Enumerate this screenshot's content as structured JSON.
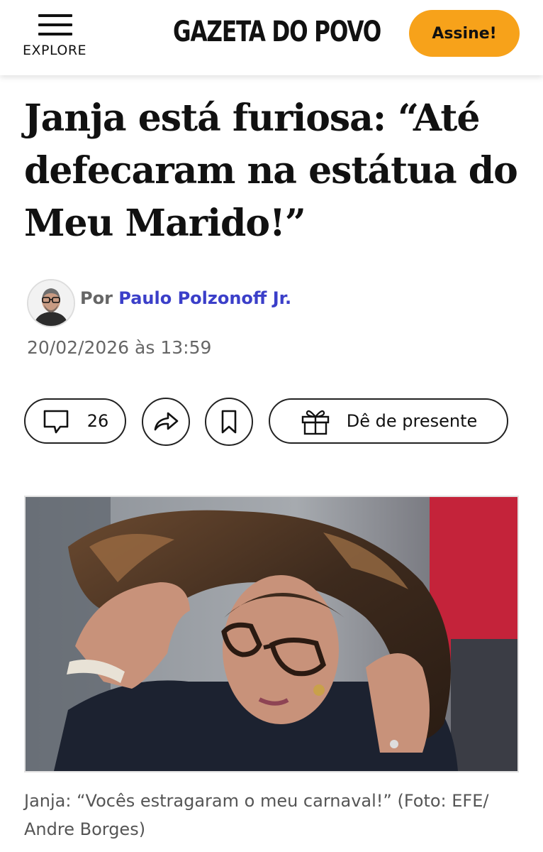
{
  "header": {
    "explore_label": "EXPLORE",
    "logo_text": "GAZETA DO POVO",
    "subscribe_label": "Assine!"
  },
  "article": {
    "headline": "Janja está furiosa: “Até defecaram na estátua do Meu Marido!”",
    "byline_prefix": "Por",
    "author": "Paulo Polzonoff Jr.",
    "date": "20/02/2026 às 13:59"
  },
  "actions": {
    "comment_count": "26",
    "gift_label": "Dê de presente"
  },
  "photo": {
    "caption": "Janja: “Vocês estragaram o meu carnaval!” (Foto: EFE/ Andre Borges)"
  },
  "colors": {
    "accent": "#f7a21a",
    "author_link": "#3b3fc9"
  }
}
